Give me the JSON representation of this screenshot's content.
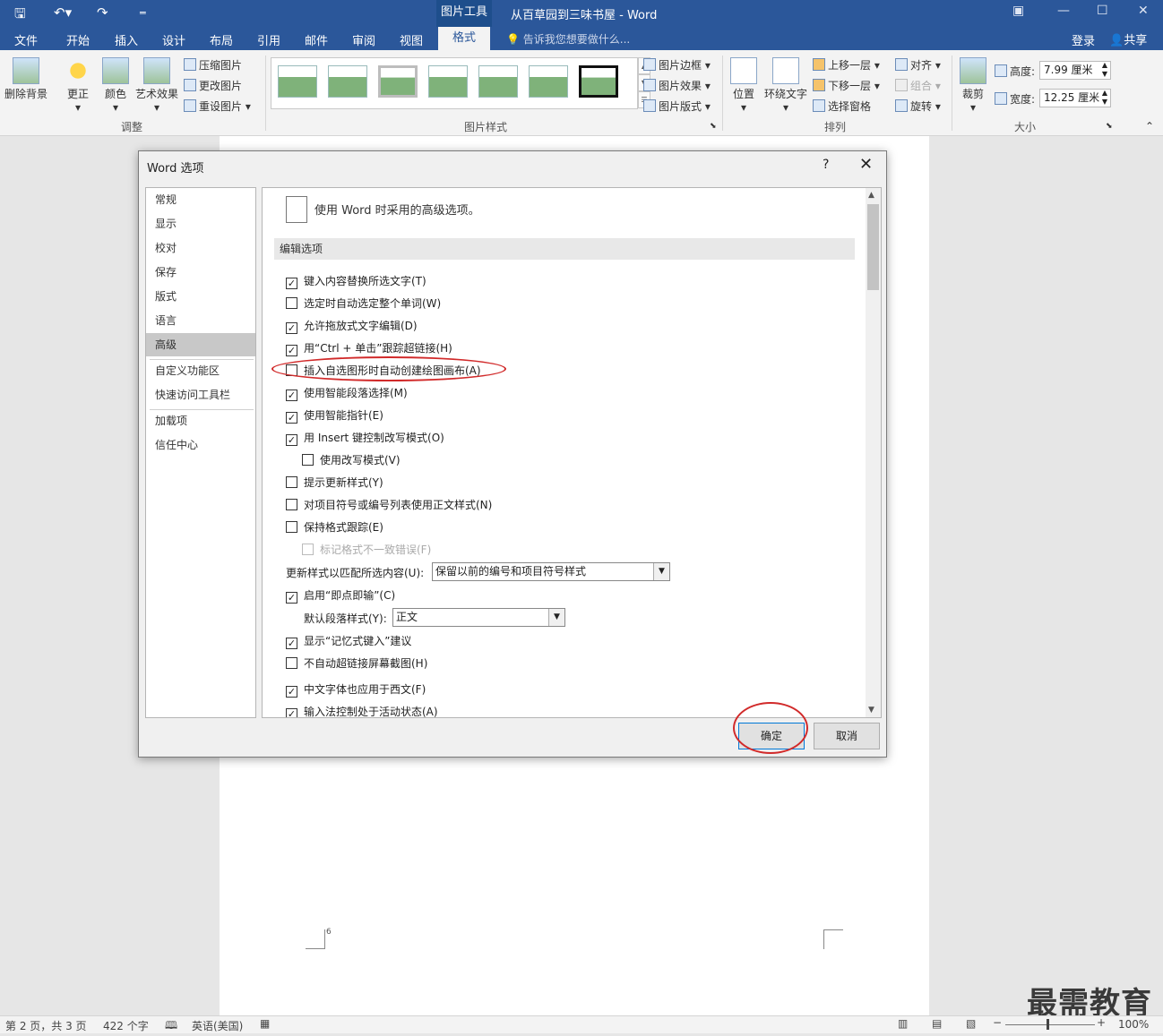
{
  "titlebar": {
    "picture_tools": "图片工具",
    "doc_title": "从百草园到三味书屋 - Word",
    "undo_icon": "undo-icon",
    "redo_icon": "redo-icon"
  },
  "tabs": {
    "file": "文件",
    "home": "开始",
    "insert": "插入",
    "design": "设计",
    "layout": "布局",
    "references": "引用",
    "mailings": "邮件",
    "review": "审阅",
    "view": "视图",
    "format": "格式",
    "tellme": "告诉我您想要做什么...",
    "signin": "登录",
    "share": "共享"
  },
  "ribbon": {
    "remove_bg": "删除背景",
    "corrections": "更正",
    "color": "颜色",
    "artistic": "艺术效果",
    "compress": "压缩图片",
    "change": "更改图片",
    "reset": "重设图片",
    "group_adjust": "调整",
    "border": "图片边框",
    "effects": "图片效果",
    "pic_layout": "图片版式",
    "group_styles": "图片样式",
    "position": "位置",
    "wrap": "环绕文字",
    "bring_forward": "上移一层",
    "send_backward": "下移一层",
    "selection_pane": "选择窗格",
    "align": "对齐",
    "group": "组合",
    "rotate": "旋转",
    "group_arrange": "排列",
    "crop": "裁剪",
    "height_label": "高度:",
    "height_value": "7.99 厘米",
    "width_label": "宽度:",
    "width_value": "12.25 厘米",
    "group_size": "大小"
  },
  "statusbar": {
    "page": "第 2 页，共 3 页",
    "words": "422 个字",
    "lang": "英语(美国)",
    "zoom": "100%"
  },
  "page_number": "6",
  "watermark": "最需教育",
  "dialog": {
    "title": "Word 选项",
    "help": "?",
    "close": "✕",
    "nav": [
      "常规",
      "显示",
      "校对",
      "保存",
      "版式",
      "语言",
      "高级",
      "自定义功能区",
      "快速访问工具栏",
      "加载项",
      "信任中心"
    ],
    "header": "使用 Word 时采用的高级选项。",
    "section": "编辑选项",
    "options": [
      {
        "label": "键入内容替换所选文字(T)",
        "checked": true
      },
      {
        "label": "选定时自动选定整个单词(W)",
        "checked": false
      },
      {
        "label": "允许拖放式文字编辑(D)",
        "checked": true
      },
      {
        "label": "用“Ctrl + 单击”跟踪超链接(H)",
        "checked": true
      },
      {
        "label": "插入自选图形时自动创建绘图画布(A)",
        "checked": false
      },
      {
        "label": "使用智能段落选择(M)",
        "checked": true
      },
      {
        "label": "使用智能指针(E)",
        "checked": true
      },
      {
        "label": "用 Insert 键控制改写模式(O)",
        "checked": true
      },
      {
        "label": "使用改写模式(V)",
        "checked": false
      },
      {
        "label": "提示更新样式(Y)",
        "checked": false
      },
      {
        "label": "对项目符号或编号列表使用正文样式(N)",
        "checked": false
      },
      {
        "label": "保持格式跟踪(E)",
        "checked": false
      },
      {
        "label": "标记格式不一致错误(F)",
        "checked": false
      },
      {
        "label": "启用“即点即输”(C)",
        "checked": true
      },
      {
        "label": "显示“记忆式键入”建议",
        "checked": true
      },
      {
        "label": "不自动超链接屏幕截图(H)",
        "checked": false
      },
      {
        "label": "中文字体也应用于西文(F)",
        "checked": true
      },
      {
        "label": "输入法控制处于活动状态(A)",
        "checked": true
      }
    ],
    "update_style_label": "更新样式以匹配所选内容(U):",
    "update_style_value": "保留以前的编号和项目符号样式",
    "default_para_label": "默认段落样式(Y):",
    "default_para_value": "正文",
    "ok": "确定",
    "cancel": "取消"
  }
}
